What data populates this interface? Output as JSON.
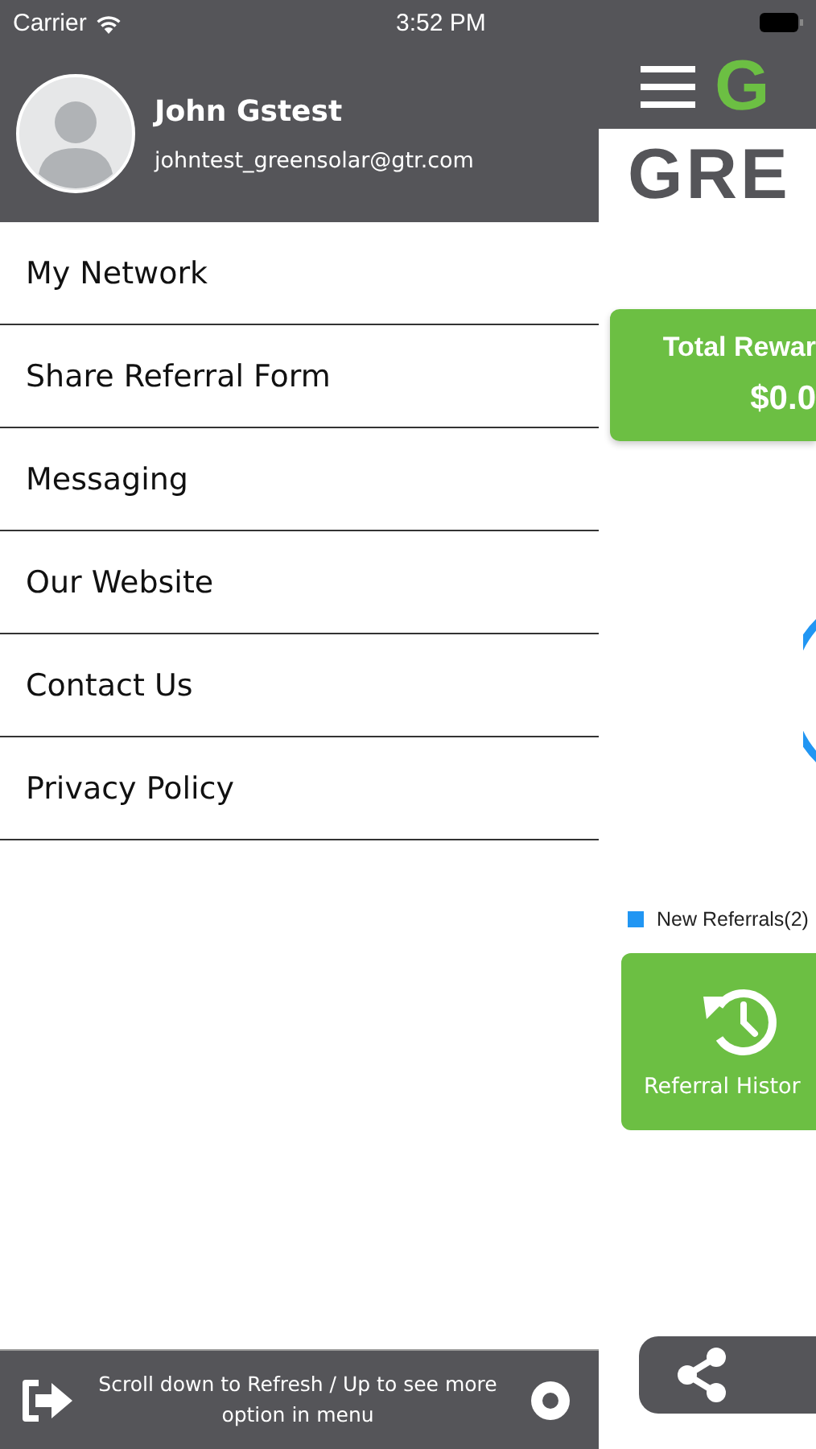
{
  "status_bar": {
    "carrier": "Carrier",
    "time": "3:52 PM"
  },
  "drawer": {
    "profile": {
      "name": "John Gstest",
      "email": "johntest_greensolar@gtr.com"
    },
    "items": [
      {
        "label": "My Network"
      },
      {
        "label": "Share Referral Form"
      },
      {
        "label": "Messaging"
      },
      {
        "label": "Our Website"
      },
      {
        "label": "Contact Us"
      },
      {
        "label": "Privacy Policy"
      }
    ],
    "footer": {
      "hint": "Scroll down to Refresh / Up to see more option in menu"
    }
  },
  "background_screen": {
    "logo_mark": "G",
    "logo_text": "GRE",
    "rewards_card": {
      "title": "Total Rewar",
      "value": "$0.0"
    },
    "legend": [
      {
        "label": "New Referrals(2)",
        "color": "#2196f3"
      }
    ],
    "history_button": {
      "label": "Referral Histor"
    }
  }
}
